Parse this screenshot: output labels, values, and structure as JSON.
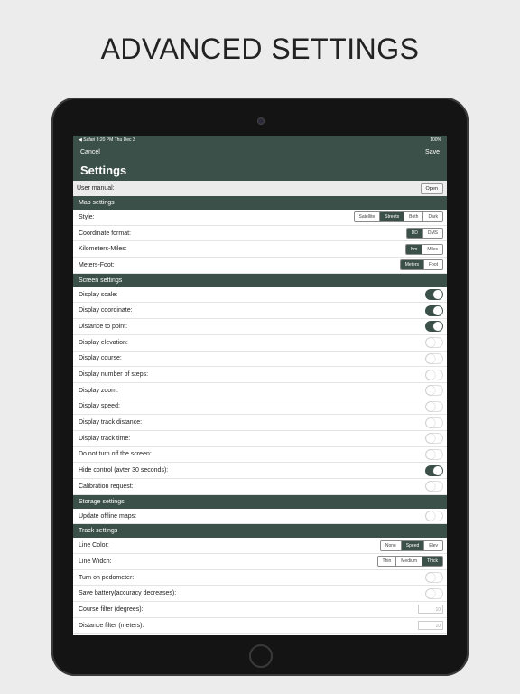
{
  "headline": "ADVANCED SETTINGS",
  "status_bar": {
    "left": "◀ Safari   3:20 PM   Thu Dec 3",
    "right": "100%"
  },
  "nav": {
    "cancel": "Cancel",
    "save": "Save",
    "title": "Settings"
  },
  "manual": {
    "label": "User manual:",
    "button": "Open"
  },
  "sections": {
    "map": "Map settings",
    "screen": "Screen settings",
    "storage": "Storage settings",
    "track": "Track settings"
  },
  "map_rows": [
    {
      "label": "Style:",
      "options": [
        "Satellite",
        "Streets",
        "Both",
        "Dark"
      ],
      "selected": "Streets"
    },
    {
      "label": "Coordinate format:",
      "options": [
        "DD",
        "DMS"
      ],
      "selected": "DD"
    },
    {
      "label": "Kilometers-Miles:",
      "options": [
        "Km",
        "Miles"
      ],
      "selected": "Km"
    },
    {
      "label": "Meters-Foot:",
      "options": [
        "Meters",
        "Foot"
      ],
      "selected": "Meters"
    }
  ],
  "screen_rows": [
    {
      "label": "Display scale:",
      "on": true
    },
    {
      "label": "Display coordinate:",
      "on": true
    },
    {
      "label": "Distance to point:",
      "on": true
    },
    {
      "label": "Display elevation:",
      "on": false
    },
    {
      "label": "Display course:",
      "on": false
    },
    {
      "label": "Display number of steps:",
      "on": false
    },
    {
      "label": "Display zoom:",
      "on": false
    },
    {
      "label": "Display speed:",
      "on": false
    },
    {
      "label": "Display track distance:",
      "on": false
    },
    {
      "label": "Display track time:",
      "on": false
    },
    {
      "label": "Do not turn off the screen:",
      "on": false
    },
    {
      "label": "Hide control (avter 30 seconds):",
      "on": true
    },
    {
      "label": "Calibration request:",
      "on": false
    }
  ],
  "storage_rows": [
    {
      "label": "Update offline maps:",
      "on": false
    }
  ],
  "track": {
    "line_color": {
      "label": "Line Color:",
      "options": [
        "None",
        "Speed",
        "Elev"
      ],
      "selected": "Speed"
    },
    "line_width": {
      "label": "Line Widch:",
      "options": [
        "Thin",
        "Medium",
        "Thick"
      ],
      "selected": "Thick"
    },
    "pedometer": {
      "label": "Turn on pedometer:",
      "on": false
    },
    "battery": {
      "label": "Save battery(accuracy decreases):",
      "on": false
    },
    "course_filter": {
      "label": "Course filter (degrees):",
      "value": "10"
    },
    "distance_filter": {
      "label": "Distance filter (meters):",
      "value": "10"
    }
  },
  "colors": {
    "accent": "#3b5048",
    "background": "#ececec"
  }
}
